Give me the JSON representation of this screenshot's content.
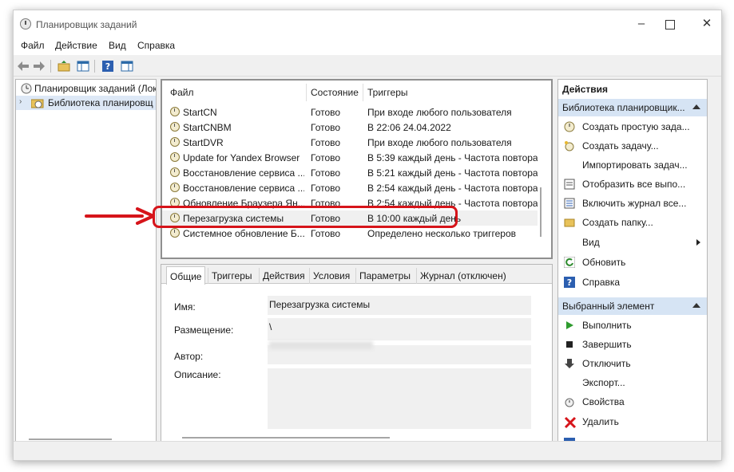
{
  "window": {
    "title": "Планировщик заданий"
  },
  "menu": [
    "Файл",
    "Действие",
    "Вид",
    "Справка"
  ],
  "tree": {
    "root": "Планировщик заданий (Лок",
    "library": "Библиотека планировщ"
  },
  "task_list": {
    "columns": [
      "Файл",
      "Состояние",
      "Триггеры"
    ],
    "rows": [
      {
        "name": "StartCN",
        "status": "Готово",
        "trigger": "При входе любого пользователя"
      },
      {
        "name": "StartCNBM",
        "status": "Готово",
        "trigger": "В 22:06 24.04.2022"
      },
      {
        "name": "StartDVR",
        "status": "Готово",
        "trigger": "При входе любого пользователя"
      },
      {
        "name": "Update for Yandex Browser",
        "status": "Готово",
        "trigger": "В 5:39 каждый день - Частота повтора"
      },
      {
        "name": "Восстановление сервиса ...",
        "status": "Готово",
        "trigger": "В 5:21 каждый день - Частота повтора"
      },
      {
        "name": "Восстановление сервиса ...",
        "status": "Готово",
        "trigger": "В 2:54 каждый день - Частота повтора"
      },
      {
        "name": "Обновление Браузера Ян...",
        "status": "Готово",
        "trigger": "В 2:54 каждый день - Частота повтора"
      },
      {
        "name": "Перезагрузка системы",
        "status": "Готово",
        "trigger": "В 10:00 каждый день"
      },
      {
        "name": "Системное обновление Б...",
        "status": "Готово",
        "trigger": "Определено несколько триггеров"
      }
    ],
    "selected_index": 7
  },
  "details": {
    "tabs": [
      "Общие",
      "Триггеры",
      "Действия",
      "Условия",
      "Параметры",
      "Журнал (отключен)"
    ],
    "active_tab": 0,
    "name_label": "Имя:",
    "name_value": "Перезагрузка системы",
    "location_label": "Размещение:",
    "location_value": "\\",
    "author_label": "Автор:",
    "description_label": "Описание:"
  },
  "actions": {
    "title": "Действия",
    "library_section": "Библиотека планировщик...",
    "library_items": [
      {
        "label": "Создать простую зада...",
        "icon": "create-basic-task-icon"
      },
      {
        "label": "Создать задачу...",
        "icon": "create-task-icon"
      },
      {
        "label": "Импортировать задач...",
        "icon": ""
      },
      {
        "label": "Отобразить все выпо...",
        "icon": "running-tasks-icon"
      },
      {
        "label": "Включить журнал все...",
        "icon": "enable-history-icon"
      },
      {
        "label": "Создать папку...",
        "icon": "new-folder-icon"
      },
      {
        "label": "Вид",
        "icon": ""
      },
      {
        "label": "Обновить",
        "icon": "refresh-icon"
      },
      {
        "label": "Справка",
        "icon": "help-icon"
      }
    ],
    "selected_section": "Выбранный элемент",
    "selected_items": [
      {
        "label": "Выполнить",
        "icon": "run-icon"
      },
      {
        "label": "Завершить",
        "icon": "stop-icon"
      },
      {
        "label": "Отключить",
        "icon": "disable-icon"
      },
      {
        "label": "Экспорт...",
        "icon": ""
      },
      {
        "label": "Свойства",
        "icon": "properties-icon"
      },
      {
        "label": "Удалить",
        "icon": "delete-icon"
      }
    ]
  },
  "colors": {
    "highlight": "#d6141a",
    "section_header": "#d6e4f4"
  }
}
